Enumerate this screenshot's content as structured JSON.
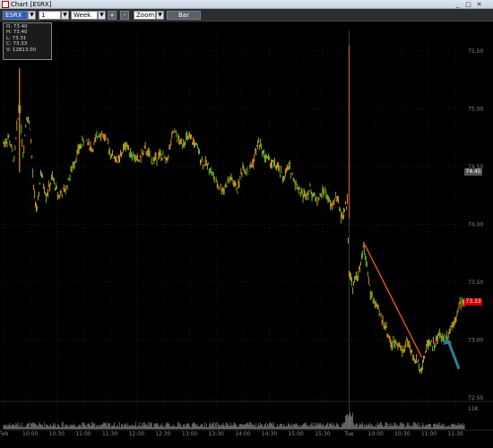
{
  "window": {
    "title": "Chart [ESRX]",
    "buttons": [
      "_",
      "□",
      "✕"
    ]
  },
  "toolbar": {
    "symbol": "ESRX",
    "interval": "1 minute",
    "range": "Week",
    "zoom_in": "+",
    "zoom_out": "-",
    "zoom_mode": "Zoom",
    "chart_type": "Bar"
  },
  "info": {
    "header": "",
    "open": "O: 73.40",
    "high": "H: 73.40",
    "low": "L: 73.31",
    "close": "C: 73.33",
    "volume": "V: 12813.00"
  },
  "colors": {
    "background": "#000000",
    "bars_up": "#f0a020",
    "bars_down": "#7fc02a",
    "grid": "#2a2a2a",
    "trendline": "#e2562a",
    "arrow": "#2e7f94",
    "last_price_flag": "#cc0000",
    "prev_price_flag": "#555555"
  },
  "chart_data": {
    "type": "line",
    "ylim": [
      72.5,
      75.6
    ],
    "y_ticks": [
      "75.50",
      "75.00",
      "74.50",
      "74.00",
      "73.50",
      "73.00",
      "72.50"
    ],
    "x_ticks": [
      "Feb",
      "10:00",
      "10:30",
      "11:00",
      "11:30",
      "12:00",
      "12:30",
      "13:00",
      "13:30",
      "14:00",
      "14:30",
      "15:00",
      "15:30",
      "Tue",
      "10:00",
      "10:30",
      "11:00",
      "11:30"
    ],
    "x_tick_pos": [
      0,
      30,
      60,
      90,
      120,
      150,
      180,
      210,
      240,
      270,
      300,
      330,
      360,
      390,
      420,
      450,
      480,
      510
    ],
    "x_max": 520,
    "prev_price_label": "74.45",
    "last_price_label": "73.33",
    "volume_label": "11K",
    "volume_range": [
      0,
      12
    ],
    "series": [
      {
        "values": [
          [
            0,
            74.7
          ],
          [
            6,
            74.75
          ],
          [
            12,
            74.55
          ],
          [
            18,
            75.1
          ],
          [
            22,
            74.6
          ],
          [
            26,
            74.95
          ],
          [
            30,
            74.85
          ],
          [
            34,
            74.3
          ],
          [
            38,
            74.1
          ],
          [
            42,
            74.45
          ],
          [
            48,
            74.25
          ],
          [
            55,
            74.4
          ],
          [
            62,
            74.25
          ],
          [
            70,
            74.3
          ],
          [
            78,
            74.5
          ],
          [
            85,
            74.65
          ],
          [
            92,
            74.75
          ],
          [
            100,
            74.65
          ],
          [
            108,
            74.8
          ],
          [
            115,
            74.75
          ],
          [
            122,
            74.6
          ],
          [
            130,
            74.55
          ],
          [
            138,
            74.7
          ],
          [
            145,
            74.6
          ],
          [
            152,
            74.55
          ],
          [
            160,
            74.65
          ],
          [
            168,
            74.55
          ],
          [
            176,
            74.6
          ],
          [
            184,
            74.55
          ],
          [
            192,
            74.8
          ],
          [
            200,
            74.7
          ],
          [
            208,
            74.75
          ],
          [
            216,
            74.7
          ],
          [
            224,
            74.55
          ],
          [
            232,
            74.5
          ],
          [
            240,
            74.35
          ],
          [
            248,
            74.3
          ],
          [
            256,
            74.4
          ],
          [
            264,
            74.3
          ],
          [
            270,
            74.5
          ],
          [
            276,
            74.45
          ],
          [
            282,
            74.55
          ],
          [
            288,
            74.72
          ],
          [
            294,
            74.6
          ],
          [
            300,
            74.55
          ],
          [
            308,
            74.5
          ],
          [
            316,
            74.4
          ],
          [
            322,
            74.5
          ],
          [
            330,
            74.35
          ],
          [
            338,
            74.25
          ],
          [
            346,
            74.3
          ],
          [
            354,
            74.2
          ],
          [
            362,
            74.3
          ],
          [
            370,
            74.15
          ],
          [
            376,
            74.25
          ],
          [
            382,
            74.05
          ],
          [
            388,
            74.2
          ],
          [
            390,
            73.6
          ],
          [
            394,
            73.45
          ],
          [
            398,
            73.55
          ],
          [
            402,
            73.6
          ],
          [
            406,
            73.8
          ],
          [
            410,
            73.65
          ],
          [
            414,
            73.4
          ],
          [
            420,
            73.3
          ],
          [
            426,
            73.2
          ],
          [
            432,
            73.1
          ],
          [
            438,
            72.95
          ],
          [
            444,
            73.0
          ],
          [
            450,
            72.9
          ],
          [
            456,
            73.0
          ],
          [
            462,
            72.85
          ],
          [
            468,
            72.8
          ],
          [
            472,
            72.75
          ],
          [
            476,
            72.9
          ],
          [
            480,
            73.0
          ],
          [
            486,
            72.95
          ],
          [
            492,
            73.05
          ],
          [
            498,
            73.0
          ],
          [
            504,
            73.1
          ],
          [
            510,
            73.2
          ],
          [
            516,
            73.33
          ]
        ]
      }
    ],
    "spike": {
      "x": 390,
      "high": 75.55,
      "low": 74.05
    },
    "trendline": [
      [
        406,
        73.85
      ],
      [
        472,
        72.85
      ]
    ],
    "arrow": {
      "from": [
        514,
        72.75
      ],
      "to": [
        500,
        73.02
      ]
    }
  }
}
